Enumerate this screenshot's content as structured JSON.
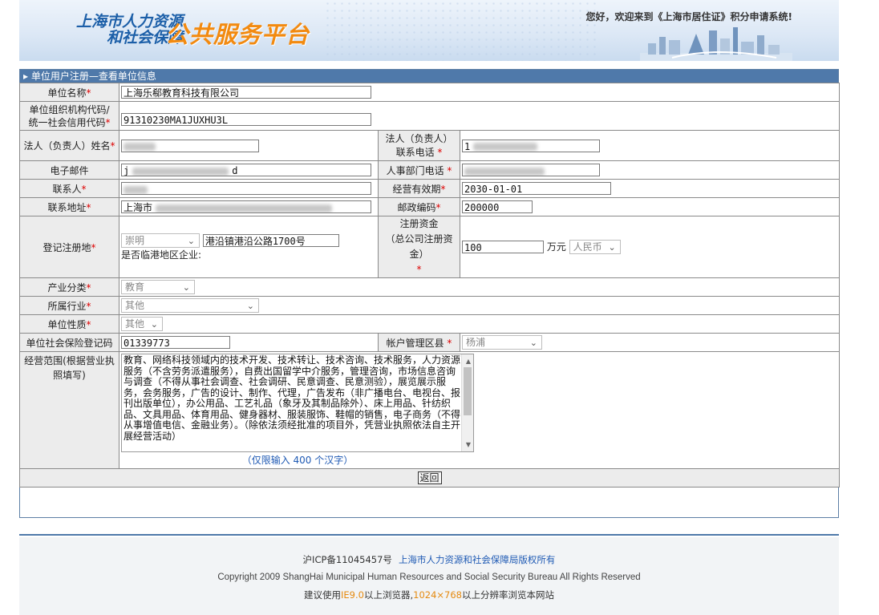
{
  "header": {
    "logo_line1": "上海市人力资源",
    "logo_line2": "和社会保障",
    "logo_platform": "公共服务平台",
    "welcome": "您好，欢迎来到《上海市居住证》积分申请系统!"
  },
  "section_title": "▸ 单位用户注册—查看单位信息",
  "fields": {
    "company_name": {
      "label": "单位名称",
      "value": "上海乐郗教育科技有限公司"
    },
    "org_code": {
      "label_line1": "单位组织机构代码/",
      "label_line2": "统一社会信用代码",
      "value": "91310230MA1JUXHU3L"
    },
    "legal_name": {
      "label": "法人（负责人）姓名"
    },
    "legal_phone": {
      "label_line1": "法人（负责人）",
      "label_line2": "联系电话",
      "value_prefix": "1"
    },
    "email": {
      "label": "电子邮件",
      "value_prefix": "j",
      "value_suffix": "d"
    },
    "hr_phone": {
      "label": "人事部门电话"
    },
    "contact": {
      "label": "联系人"
    },
    "valid_period": {
      "label": "经营有效期",
      "value": "2030-01-01"
    },
    "address": {
      "label": "联系地址",
      "value_prefix": "上海市"
    },
    "postcode": {
      "label": "邮政编码",
      "value": "200000"
    },
    "reg_place": {
      "label": "登记注册地",
      "district": "崇明",
      "street": "港沿镇港沿公路1700号",
      "note": "是否临港地区企业:"
    },
    "capital": {
      "label_line1": "注册资金",
      "label_line2": "（总公司注册资金）",
      "value": "100",
      "unit": "万元",
      "currency": "人民币"
    },
    "industry_class": {
      "label": "产业分类",
      "value": "教育"
    },
    "industry": {
      "label": "所属行业",
      "value": "其他"
    },
    "nature": {
      "label": "单位性质",
      "value": "其他"
    },
    "insurance_code": {
      "label": "单位社会保险登记码",
      "value": "01339773"
    },
    "account_district": {
      "label": "帐户管理区县",
      "value": "杨浦"
    },
    "scope": {
      "label": "经营范围(根据营业执照填写)",
      "text": "教育、网络科技领域内的技术开发、技术转让、技术咨询、技术服务，人力资源服务（不含劳务派遣服务），自费出国留学中介服务，管理咨询，市场信息咨询与调查（不得从事社会调查、社会调研、民意调查、民意测验），展览展示服务，会务服务，广告的设计、制作、代理，广告发布（非广播电台、电视台、报刊出版单位），办公用品、工艺礼品（象牙及其制品除外）、床上用品、针纺织品、文具用品、体育用品、健身器材、服装服饰、鞋帽的销售，电子商务（不得从事增值电信、金融业务）。（除依法须经批准的项目外，凭营业执照依法自主开展经营活动）",
      "limit": "（仅限输入 400 个汉字）"
    }
  },
  "required_mark": "*",
  "back_button": "返回",
  "footer": {
    "icp": "沪ICP备11045457号",
    "rights": "上海市人力资源和社会保障局版权所有",
    "copyright": "Copyright 2009 ShangHai Municipal Human Resources and Social Security Bureau All Rights Reserved",
    "tip_a": "建议使用",
    "tip_ie": "IE9.0",
    "tip_b": "以上浏览器,",
    "tip_res": "1024×768",
    "tip_c": "以上分辨率浏览本网站"
  },
  "colors": {
    "accent": "#4f79aa",
    "required": "#dd0000",
    "logo_blue": "#1c5fa8",
    "logo_orange": "#f28a10",
    "link": "#1f5ab4"
  }
}
